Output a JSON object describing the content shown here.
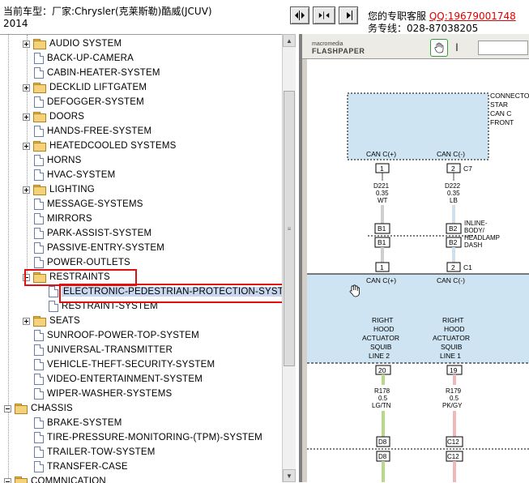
{
  "header": {
    "title": "当前车型：厂家:Chrysler(克莱斯勒)酷威(JCUV)",
    "year": "2014",
    "contact_line1_prefix": "您的专职客服",
    "contact_qq": "QQ:19679001748",
    "contact_line2": "务专线：028-87038205"
  },
  "tree": {
    "items": [
      {
        "label": "AUDIO SYSTEM",
        "kind": "folder"
      },
      {
        "label": "BACK-UP-CAMERA",
        "kind": "doc"
      },
      {
        "label": "CABIN-HEATER-SYSTEM",
        "kind": "doc"
      },
      {
        "label": "DECKLID LIFTGATEM",
        "kind": "folder"
      },
      {
        "label": "DEFOGGER-SYSTEM",
        "kind": "doc"
      },
      {
        "label": "DOORS",
        "kind": "folder"
      },
      {
        "label": "HANDS-FREE-SYSTEM",
        "kind": "doc"
      },
      {
        "label": "HEATEDCOOLED SYSTEMS",
        "kind": "folder"
      },
      {
        "label": "HORNS",
        "kind": "doc"
      },
      {
        "label": "HVAC-SYSTEM",
        "kind": "doc"
      },
      {
        "label": "LIGHTING",
        "kind": "folder"
      },
      {
        "label": "MESSAGE-SYSTEMS",
        "kind": "doc"
      },
      {
        "label": "MIRRORS",
        "kind": "doc"
      },
      {
        "label": "PARK-ASSIST-SYSTEM",
        "kind": "doc"
      },
      {
        "label": "PASSIVE-ENTRY-SYSTEM",
        "kind": "doc"
      },
      {
        "label": "POWER-OUTLETS",
        "kind": "doc"
      },
      {
        "label": "RESTRAINTS",
        "kind": "folder-open"
      },
      {
        "label": "ELECTRONIC-PEDESTRIAN-PROTECTION-SYSTEM",
        "kind": "doc-selected"
      },
      {
        "label": "RESTRAINT-SYSTEM",
        "kind": "doc"
      },
      {
        "label": "SEATS",
        "kind": "folder"
      },
      {
        "label": "SUNROOF-POWER-TOP-SYSTEM",
        "kind": "doc"
      },
      {
        "label": "UNIVERSAL-TRANSMITTER",
        "kind": "doc"
      },
      {
        "label": "VEHICLE-THEFT-SECURITY-SYSTEM",
        "kind": "doc"
      },
      {
        "label": "VIDEO-ENTERTAINMENT-SYSTEM",
        "kind": "doc"
      },
      {
        "label": "WIPER-WASHER-SYSTEMS",
        "kind": "doc"
      },
      {
        "label": "CHASSIS",
        "kind": "root-folder"
      },
      {
        "label": "BRAKE-SYSTEM",
        "kind": "doc"
      },
      {
        "label": "TIRE-PRESSURE-MONITORING-(TPM)-SYSTEM",
        "kind": "doc"
      },
      {
        "label": "TRAILER-TOW-SYSTEM",
        "kind": "doc"
      },
      {
        "label": "TRANSFER-CASE",
        "kind": "doc"
      },
      {
        "label": "COMMNICATION",
        "kind": "root-folder"
      }
    ]
  },
  "viewer": {
    "logo_top": "macromedia",
    "logo_bottom": "FLASHPAPER"
  },
  "diagram": {
    "connector_label": [
      "CONNECTOR",
      "STAR",
      "CAN C",
      "FRONT"
    ],
    "can_plus": "CAN C(+)",
    "can_minus": "CAN C(-)",
    "pin1": "1",
    "pin2": "2",
    "c7": "C7",
    "wire1": [
      "D221",
      "0.35",
      "WT"
    ],
    "wire2": [
      "D222",
      "0.35",
      "LB"
    ],
    "b1": "B1",
    "b2": "B2",
    "inline_label": [
      "INLINE-",
      "BODY/",
      "HEADLAMP",
      "DASH"
    ],
    "c1": "C1",
    "actuator_left": [
      "RIGHT",
      "HOOD",
      "ACTUATOR",
      "SQUIB",
      "LINE 2"
    ],
    "actuator_right": [
      "RIGHT",
      "HOOD",
      "ACTUATOR",
      "SQUIB",
      "LINE 1"
    ],
    "pin20": "20",
    "pin19": "19",
    "wire3": [
      "R178",
      "0.5",
      "LG/TN"
    ],
    "wire4": [
      "R179",
      "0.5",
      "PK/GY"
    ],
    "d8": "D8",
    "c12": "C12"
  }
}
